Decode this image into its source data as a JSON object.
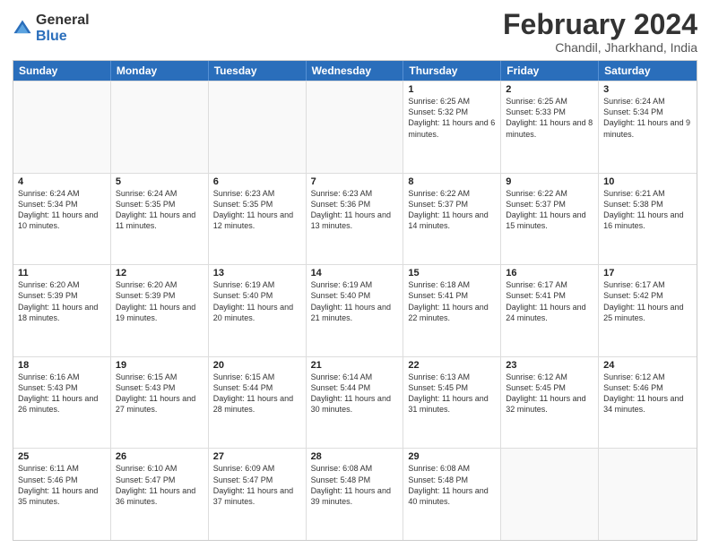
{
  "logo": {
    "general": "General",
    "blue": "Blue"
  },
  "title": {
    "main": "February 2024",
    "sub": "Chandil, Jharkhand, India"
  },
  "header_days": [
    "Sunday",
    "Monday",
    "Tuesday",
    "Wednesday",
    "Thursday",
    "Friday",
    "Saturday"
  ],
  "weeks": [
    [
      {
        "day": "",
        "info": ""
      },
      {
        "day": "",
        "info": ""
      },
      {
        "day": "",
        "info": ""
      },
      {
        "day": "",
        "info": ""
      },
      {
        "day": "1",
        "info": "Sunrise: 6:25 AM\nSunset: 5:32 PM\nDaylight: 11 hours and 6 minutes."
      },
      {
        "day": "2",
        "info": "Sunrise: 6:25 AM\nSunset: 5:33 PM\nDaylight: 11 hours and 8 minutes."
      },
      {
        "day": "3",
        "info": "Sunrise: 6:24 AM\nSunset: 5:34 PM\nDaylight: 11 hours and 9 minutes."
      }
    ],
    [
      {
        "day": "4",
        "info": "Sunrise: 6:24 AM\nSunset: 5:34 PM\nDaylight: 11 hours and 10 minutes."
      },
      {
        "day": "5",
        "info": "Sunrise: 6:24 AM\nSunset: 5:35 PM\nDaylight: 11 hours and 11 minutes."
      },
      {
        "day": "6",
        "info": "Sunrise: 6:23 AM\nSunset: 5:35 PM\nDaylight: 11 hours and 12 minutes."
      },
      {
        "day": "7",
        "info": "Sunrise: 6:23 AM\nSunset: 5:36 PM\nDaylight: 11 hours and 13 minutes."
      },
      {
        "day": "8",
        "info": "Sunrise: 6:22 AM\nSunset: 5:37 PM\nDaylight: 11 hours and 14 minutes."
      },
      {
        "day": "9",
        "info": "Sunrise: 6:22 AM\nSunset: 5:37 PM\nDaylight: 11 hours and 15 minutes."
      },
      {
        "day": "10",
        "info": "Sunrise: 6:21 AM\nSunset: 5:38 PM\nDaylight: 11 hours and 16 minutes."
      }
    ],
    [
      {
        "day": "11",
        "info": "Sunrise: 6:20 AM\nSunset: 5:39 PM\nDaylight: 11 hours and 18 minutes."
      },
      {
        "day": "12",
        "info": "Sunrise: 6:20 AM\nSunset: 5:39 PM\nDaylight: 11 hours and 19 minutes."
      },
      {
        "day": "13",
        "info": "Sunrise: 6:19 AM\nSunset: 5:40 PM\nDaylight: 11 hours and 20 minutes."
      },
      {
        "day": "14",
        "info": "Sunrise: 6:19 AM\nSunset: 5:40 PM\nDaylight: 11 hours and 21 minutes."
      },
      {
        "day": "15",
        "info": "Sunrise: 6:18 AM\nSunset: 5:41 PM\nDaylight: 11 hours and 22 minutes."
      },
      {
        "day": "16",
        "info": "Sunrise: 6:17 AM\nSunset: 5:41 PM\nDaylight: 11 hours and 24 minutes."
      },
      {
        "day": "17",
        "info": "Sunrise: 6:17 AM\nSunset: 5:42 PM\nDaylight: 11 hours and 25 minutes."
      }
    ],
    [
      {
        "day": "18",
        "info": "Sunrise: 6:16 AM\nSunset: 5:43 PM\nDaylight: 11 hours and 26 minutes."
      },
      {
        "day": "19",
        "info": "Sunrise: 6:15 AM\nSunset: 5:43 PM\nDaylight: 11 hours and 27 minutes."
      },
      {
        "day": "20",
        "info": "Sunrise: 6:15 AM\nSunset: 5:44 PM\nDaylight: 11 hours and 28 minutes."
      },
      {
        "day": "21",
        "info": "Sunrise: 6:14 AM\nSunset: 5:44 PM\nDaylight: 11 hours and 30 minutes."
      },
      {
        "day": "22",
        "info": "Sunrise: 6:13 AM\nSunset: 5:45 PM\nDaylight: 11 hours and 31 minutes."
      },
      {
        "day": "23",
        "info": "Sunrise: 6:12 AM\nSunset: 5:45 PM\nDaylight: 11 hours and 32 minutes."
      },
      {
        "day": "24",
        "info": "Sunrise: 6:12 AM\nSunset: 5:46 PM\nDaylight: 11 hours and 34 minutes."
      }
    ],
    [
      {
        "day": "25",
        "info": "Sunrise: 6:11 AM\nSunset: 5:46 PM\nDaylight: 11 hours and 35 minutes."
      },
      {
        "day": "26",
        "info": "Sunrise: 6:10 AM\nSunset: 5:47 PM\nDaylight: 11 hours and 36 minutes."
      },
      {
        "day": "27",
        "info": "Sunrise: 6:09 AM\nSunset: 5:47 PM\nDaylight: 11 hours and 37 minutes."
      },
      {
        "day": "28",
        "info": "Sunrise: 6:08 AM\nSunset: 5:48 PM\nDaylight: 11 hours and 39 minutes."
      },
      {
        "day": "29",
        "info": "Sunrise: 6:08 AM\nSunset: 5:48 PM\nDaylight: 11 hours and 40 minutes."
      },
      {
        "day": "",
        "info": ""
      },
      {
        "day": "",
        "info": ""
      }
    ]
  ]
}
